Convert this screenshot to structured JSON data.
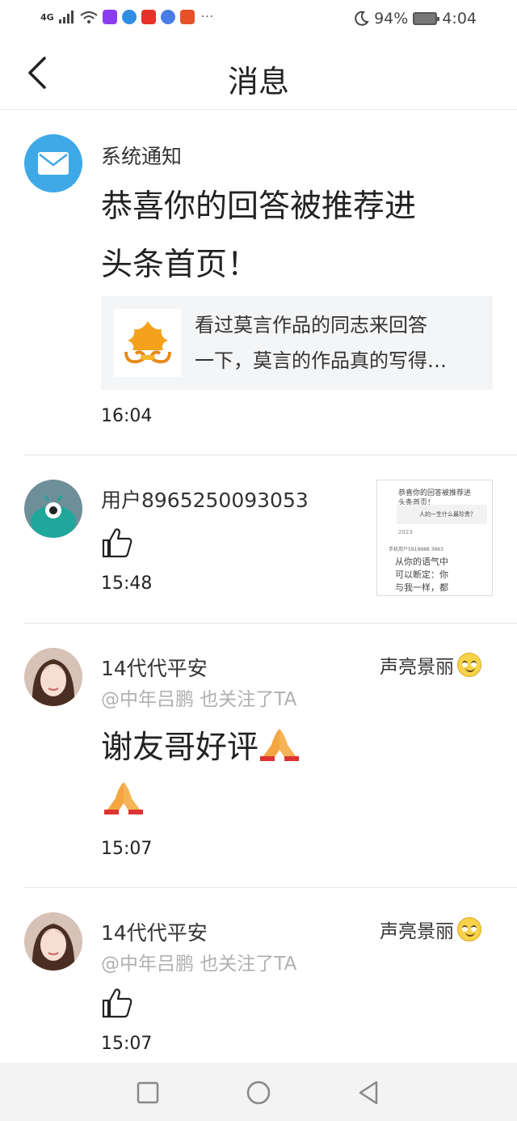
{
  "status_bar": {
    "signal": "4G",
    "battery": "94%",
    "time": "4:04",
    "more": "···"
  },
  "header": {
    "title": "消息"
  },
  "messages": [
    {
      "sender": "系统通知",
      "title_line1": "恭喜你的回答被推荐进",
      "title_line2": "头条首页！",
      "quote_line1": "看过莫言作品的同志来回答",
      "quote_line2": "一下，莫言的作品真的写得…",
      "time": "16:04",
      "icon": "mail-icon"
    },
    {
      "sender": "用户8965250093053",
      "action": "like",
      "time": "15:48",
      "thumb": {
        "line1": "恭喜你的回答被推荐进",
        "line2": "头条首页！",
        "box_text": "人的一生什么最珍贵？",
        "year": "2023",
        "user": "手机用户5919988 3663",
        "body1": "从你的语气中",
        "body2": "可以断定：你",
        "body3": "与我一样，都"
      }
    },
    {
      "sender": "14代代平安",
      "mention": "@中年吕鹏 也关注了TA",
      "right_name": "声亮景丽",
      "content": "谢友哥好评",
      "time": "15:07"
    },
    {
      "sender": "14代代平安",
      "mention": "@中年吕鹏 也关注了TA",
      "right_name": "声亮景丽",
      "action": "like",
      "time": "15:07"
    }
  ],
  "colors": {
    "mail_blue": "#3fa9e8",
    "divider": "#e6e6e6",
    "card_bg": "#f4f5f6",
    "nav_bg": "#f3f3f3"
  }
}
